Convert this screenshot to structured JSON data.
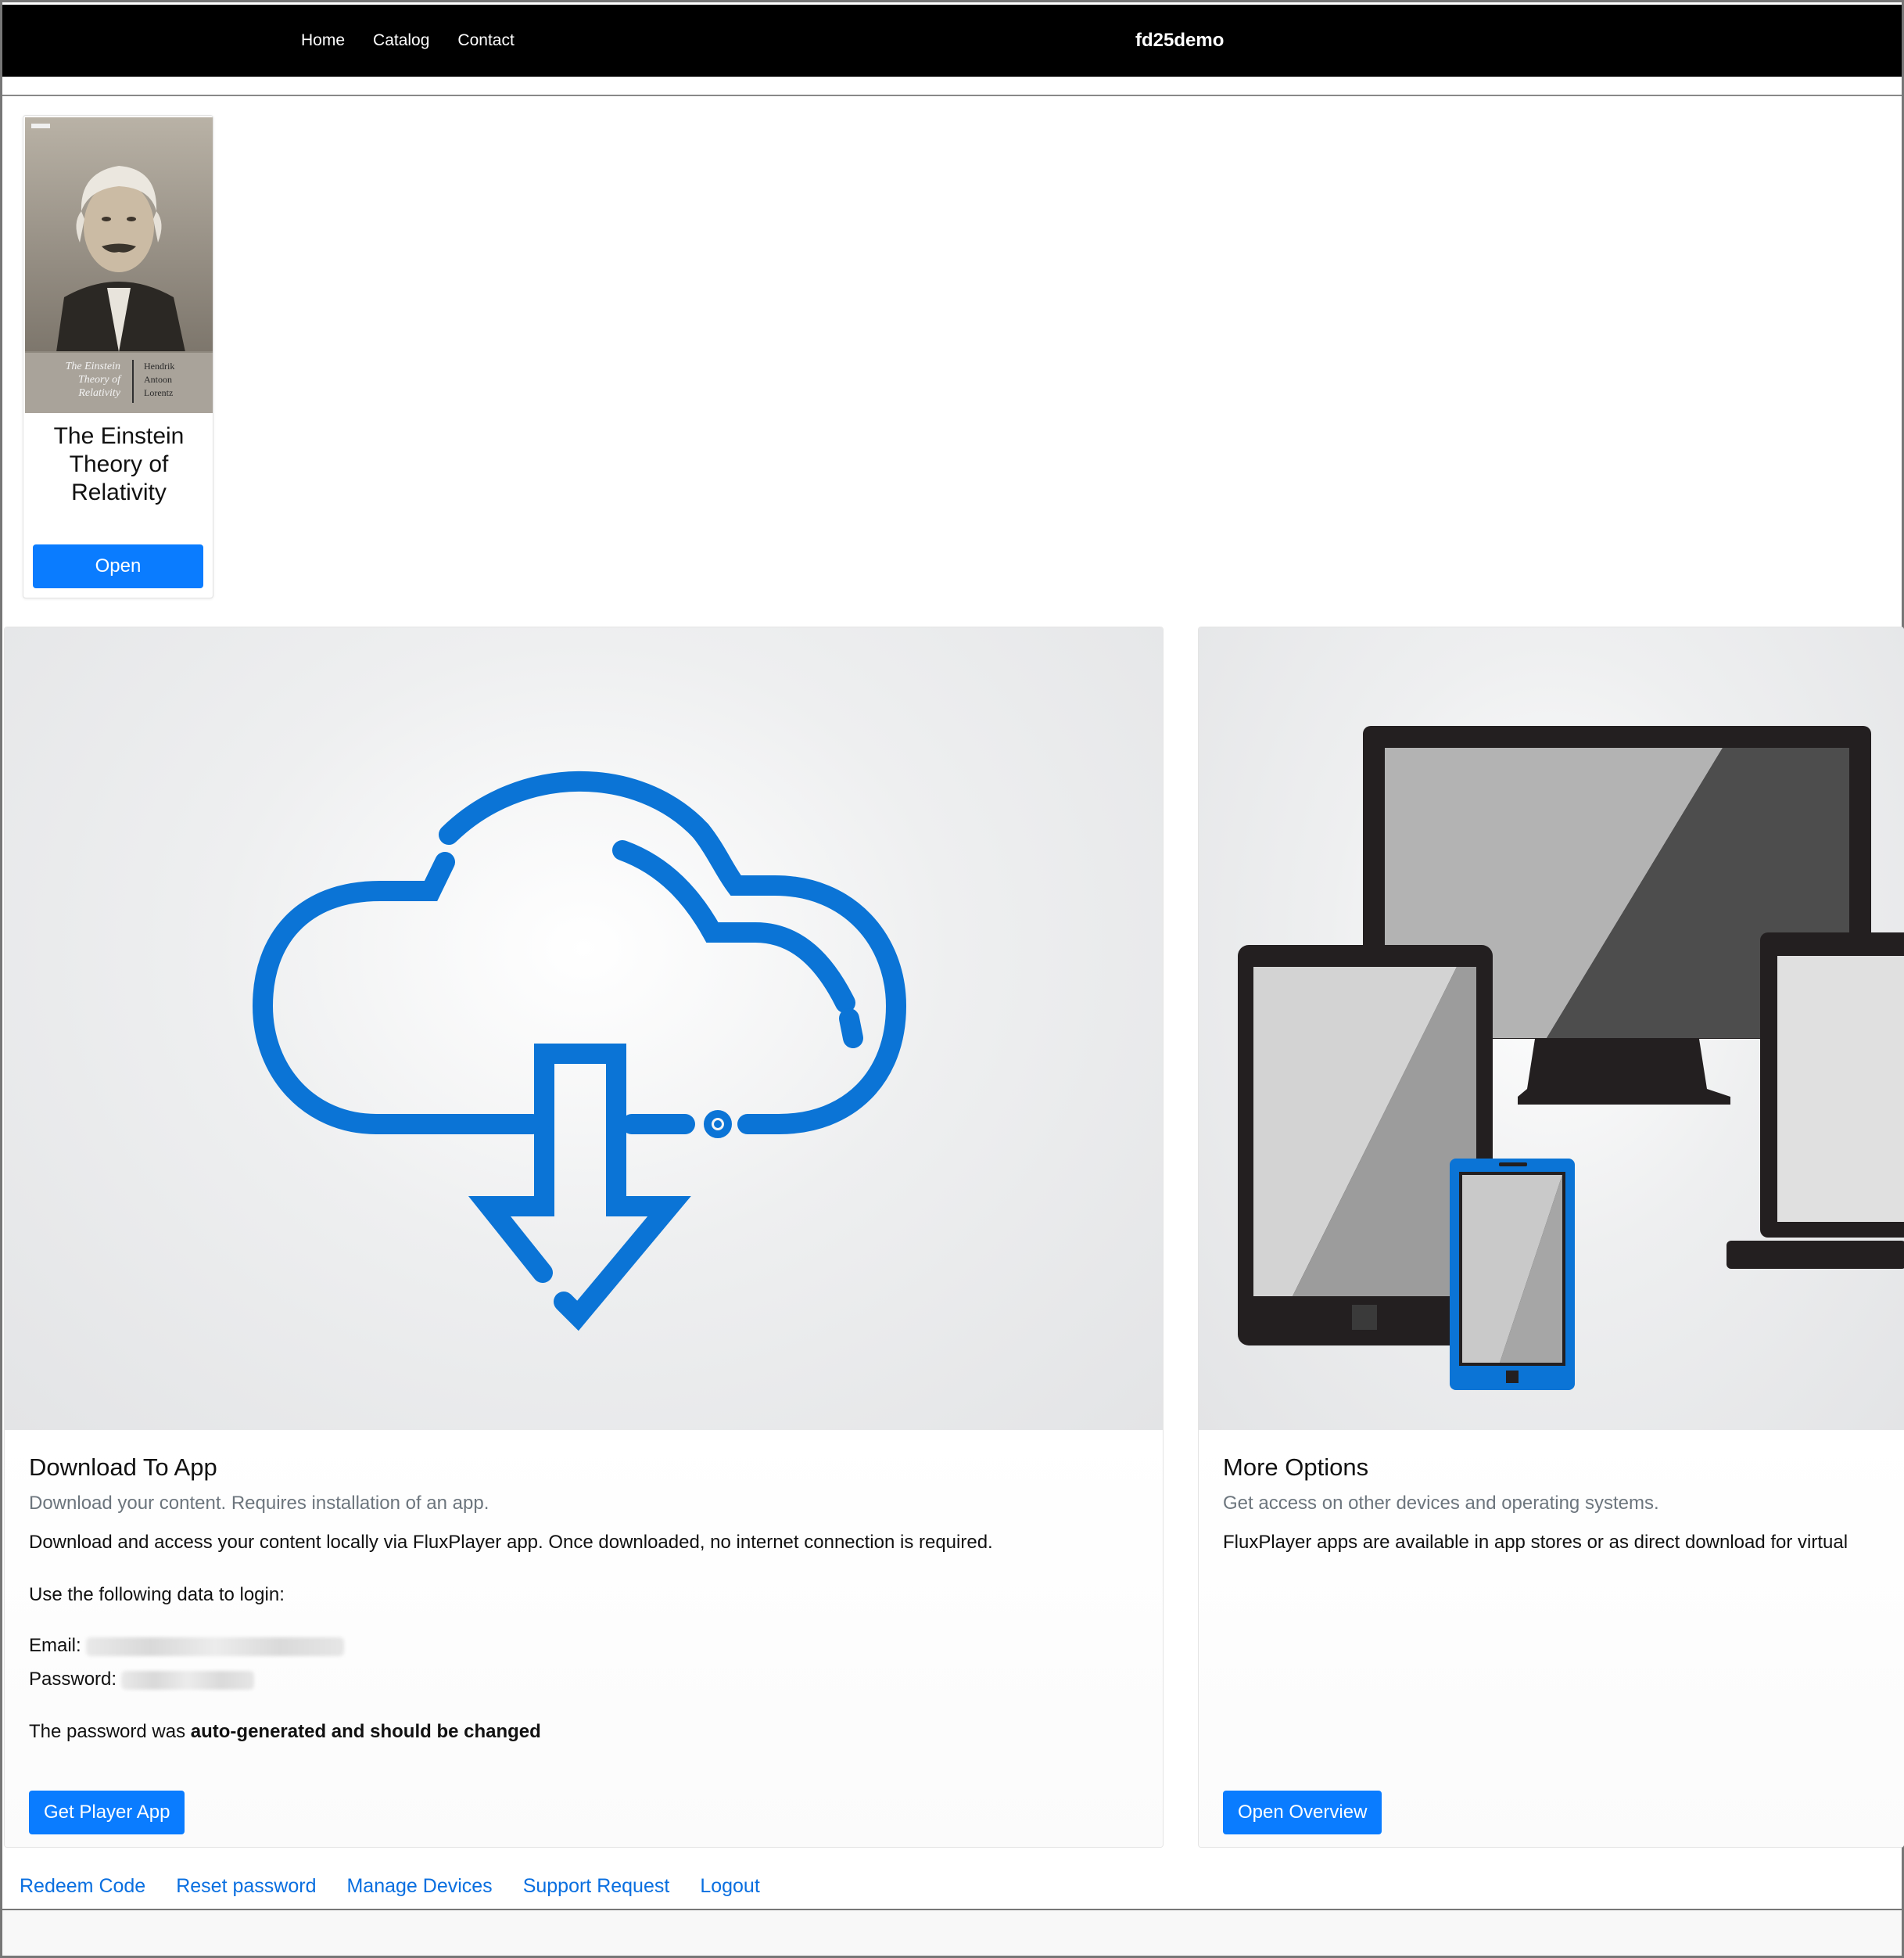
{
  "nav": {
    "links": [
      "Home",
      "Catalog",
      "Contact"
    ],
    "brand": "fd25demo"
  },
  "book": {
    "cover_title_lines": [
      "The Einstein",
      "Theory of",
      "Relativity"
    ],
    "cover_author_lines": [
      "Hendrik",
      "Antoon",
      "Lorentz"
    ],
    "title_lines": [
      "The Einstein",
      "Theory of",
      "Relativity"
    ],
    "open_label": "Open"
  },
  "download_card": {
    "title": "Download To App",
    "subtitle": "Download your content. Requires installation of an app.",
    "description": "Download and access your content locally via FluxPlayer app. Once downloaded, no internet connection is required.",
    "login_intro": "Use the following data to login:",
    "email_label": "Email:",
    "password_label": "Password:",
    "password_note_prefix": "The password was ",
    "password_note_bold": "auto-generated and should be changed",
    "button_label": "Get Player App",
    "icon": "cloud-download-icon"
  },
  "options_card": {
    "title": "More Options",
    "subtitle": "Get access on other devices and operating systems.",
    "description": "FluxPlayer apps are available in app stores or as direct download for virtual",
    "button_label": "Open Overview",
    "icon": "devices-icon"
  },
  "footer": {
    "links": [
      "Redeem Code",
      "Reset password",
      "Manage Devices",
      "Support Request",
      "Logout"
    ]
  },
  "colors": {
    "accent": "#0a7cff",
    "link": "#0a6fe0",
    "navbar": "#000000",
    "icon_blue": "#0b74d6"
  }
}
